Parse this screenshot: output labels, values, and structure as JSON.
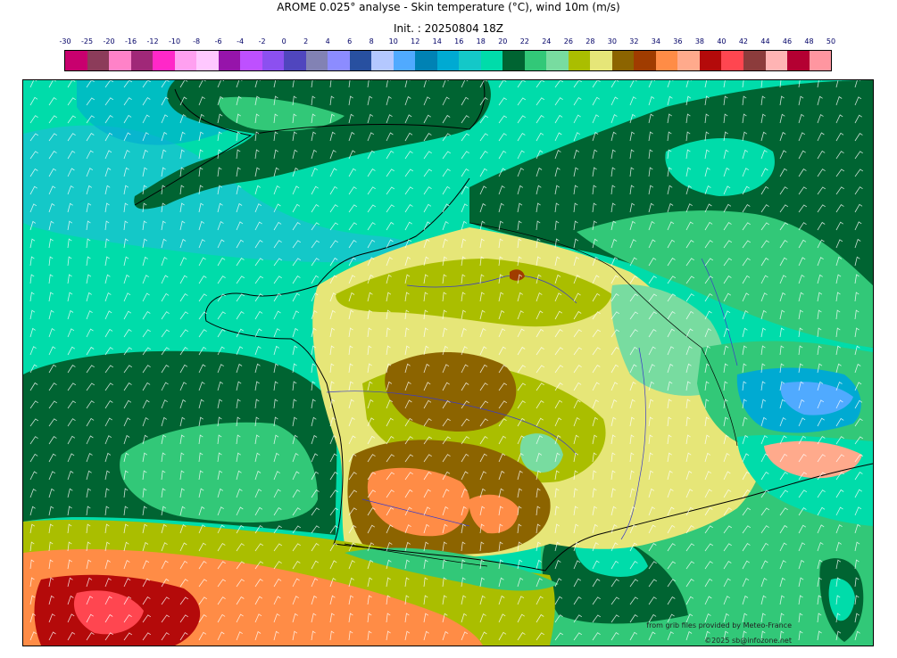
{
  "title": "AROME 0.025° analyse - Skin temperature (°C), wind 10m (m/s)",
  "subtitle": "Init. : 20250804 18Z",
  "colorbar": {
    "ticks": [
      "-30",
      "-25",
      "-20",
      "-16",
      "-12",
      "-10",
      "-8",
      "-6",
      "-4",
      "-2",
      "0",
      "2",
      "4",
      "6",
      "8",
      "10",
      "12",
      "14",
      "16",
      "18",
      "20",
      "22",
      "24",
      "26",
      "28",
      "30",
      "32",
      "34",
      "36",
      "38",
      "40",
      "42",
      "44",
      "46",
      "48",
      "50"
    ],
    "colors": [
      "#c8006e",
      "#8c3c5a",
      "#ff82c8",
      "#a02878",
      "#ff28c8",
      "#ffa0f0",
      "#ffc8ff",
      "#9614aa",
      "#be50ff",
      "#8c50f0",
      "#5046be",
      "#8282b4",
      "#8c8cff",
      "#2850a0",
      "#b4c8ff",
      "#50aaff",
      "#0082b4",
      "#00aad2",
      "#14c8c8",
      "#00dcaa",
      "#006432",
      "#32c878",
      "#78dca0",
      "#aabe00",
      "#e6e678",
      "#8c6400",
      "#a03c00",
      "#ff8c46",
      "#ffaa8c",
      "#b40a0a",
      "#ff4650",
      "#8c3c3c",
      "#ffb4b4",
      "#b40032",
      "#ff96a0"
    ]
  },
  "legend_palette": {
    "sea": "#00dcaa",
    "sea_cool": "#14c8c8",
    "temp_20": "#006432",
    "temp_22": "#32c878",
    "temp_24": "#78dca0",
    "temp_26": "#aabe00",
    "temp_28": "#e6e678",
    "temp_30": "#8c6400",
    "temp_34": "#ff8c46",
    "temp_38": "#b40a0a",
    "temp_40": "#ff4650",
    "alps_cold": "#50aaff"
  },
  "map": {
    "region": "France and surrounding areas",
    "wind_barb_color": "#ffffff",
    "coastline_color": "#000000",
    "river_color": "#3c3cc8"
  },
  "credits": {
    "line1": "from grib files provided by Meteo-France",
    "line2": "©2025 sb@infozone.net"
  }
}
